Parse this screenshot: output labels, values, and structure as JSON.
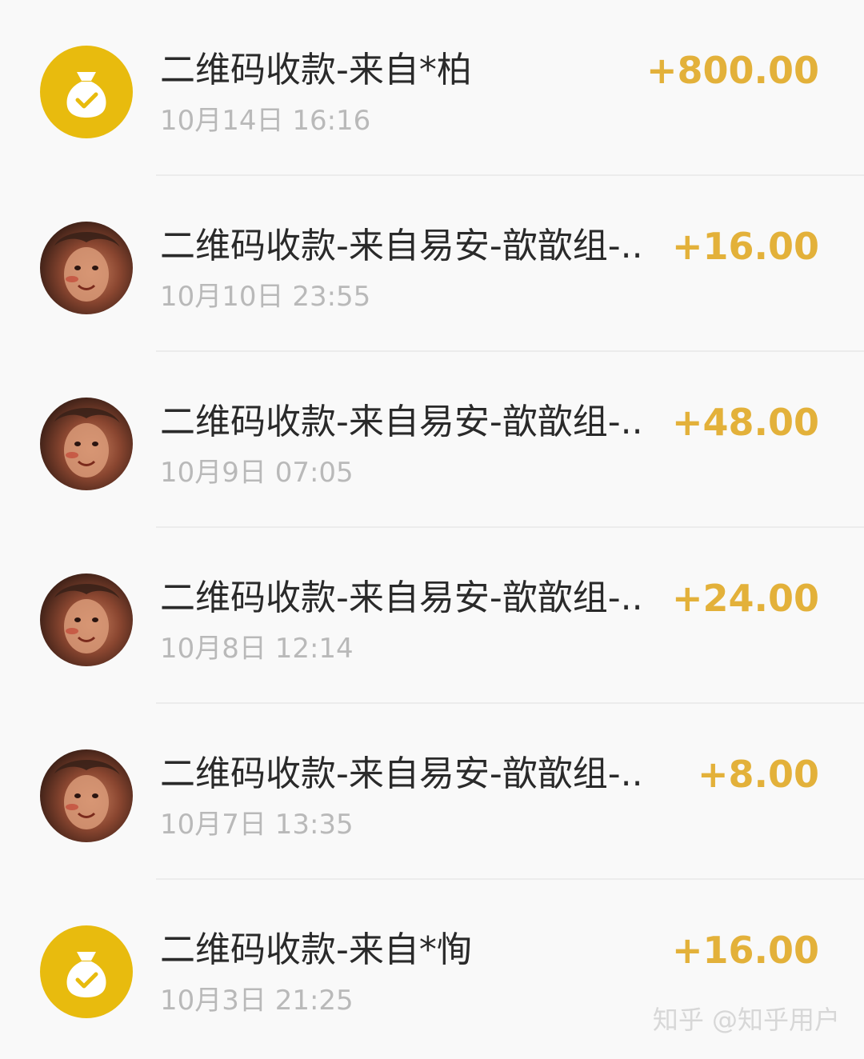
{
  "transactions": [
    {
      "avatar": "money-bag-icon",
      "title": "二维码收款-来自*柏",
      "time": "10月14日 16:16",
      "amount": "+800.00"
    },
    {
      "avatar": "user-photo",
      "title": "二维码收款-来自易安-歆歆组-...",
      "time": "10月10日 23:55",
      "amount": "+16.00"
    },
    {
      "avatar": "user-photo",
      "title": "二维码收款-来自易安-歆歆组-...",
      "time": "10月9日 07:05",
      "amount": "+48.00"
    },
    {
      "avatar": "user-photo",
      "title": "二维码收款-来自易安-歆歆组-...",
      "time": "10月8日 12:14",
      "amount": "+24.00"
    },
    {
      "avatar": "user-photo",
      "title": "二维码收款-来自易安-歆歆组-...",
      "time": "10月7日 13:35",
      "amount": "+8.00"
    },
    {
      "avatar": "money-bag-icon",
      "title": "二维码收款-来自*恂",
      "time": "10月3日 21:25",
      "amount": "+16.00"
    }
  ],
  "watermark": "知乎 @知乎用户",
  "colors": {
    "amount": "#e3b13a",
    "bag_icon_bg": "#e8bb0e",
    "title": "#2a2a2a",
    "time": "#b9b9b9",
    "background": "#f9f9f9"
  }
}
